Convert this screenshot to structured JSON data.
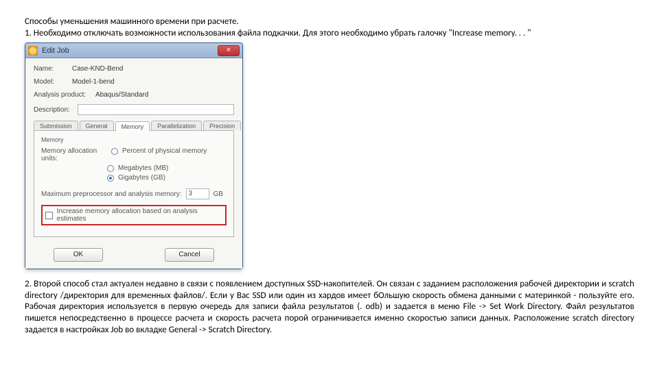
{
  "intro": {
    "line1": "Способы уменьшения машинного времени при расчете.",
    "line2": "1. Необходимо отключать возможности использования файла подкачки. Для этого необходимо убрать галочку \"Increase memory. . . \""
  },
  "dialog": {
    "window_title": "Edit Job",
    "close_glyph": "×",
    "fields": {
      "name_label": "Name:",
      "name_value": "Case-KND-Bend",
      "model_label": "Model:",
      "model_value": "Model-1-bend",
      "product_label": "Analysis product:",
      "product_value": "Abaqus/Standard",
      "description_label": "Description:"
    },
    "tabs": {
      "submission": "Submission",
      "general": "General",
      "memory": "Memory",
      "parallelization": "Parallelization",
      "precision": "Precision"
    },
    "memory_page": {
      "group_title": "Memory",
      "alloc_label": "Memory allocation units:",
      "opt_percent": "Percent of physical memory",
      "opt_mb": "Megabytes (MB)",
      "opt_gb": "Gigabytes (GB)",
      "max_label": "Maximum preprocessor and analysis memory:",
      "max_value": "3",
      "max_units": "GB",
      "increase_label": "Increase memory allocation based on analysis estimates"
    },
    "buttons": {
      "ok": "OK",
      "cancel": "Cancel"
    }
  },
  "para2": "2. Второй способ стал актуален недавно в связи с появлением доступных SSD-накопителей. Он связан с заданием расположения рабочей директории и scratch directory /директория для временных файлов/. Если у Вас SSD или один из хардов имеет бОльшую скорость обмена данными с материнкой - пользуйте его. Рабочая директория используется в первую очередь для записи файла результатов (. odb) и задается в меню File -> Set Work Directory. Файл результатов пишется непосредственно в процессе расчета и скорость расчета порой ограничивается именно скоростью записи данных. Расположение scratch directory задается в настройках Job во вкладке General -> Scratch Directory."
}
